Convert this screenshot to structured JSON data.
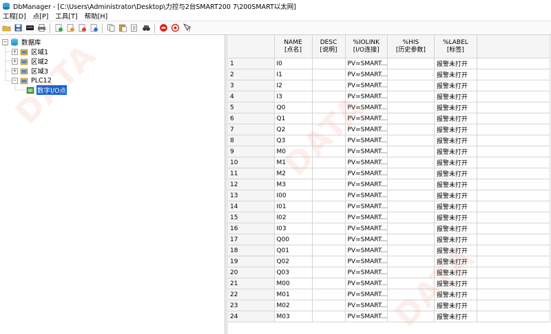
{
  "window": {
    "title": "DbManager - [C:\\Users\\Administrator\\Desktop\\力控与2台SMART200  7\\200SMART以太网]"
  },
  "menu": [
    "工程[D]",
    "点[P]",
    "工具[T]",
    "帮助[H]"
  ],
  "toolbar_icons": [
    "open-folder-icon",
    "save-icon",
    "card-icon",
    "print-icon",
    "import-icon",
    "export-icon",
    "add-point-icon",
    "delete-point-icon",
    "copy-icon",
    "paste-icon",
    "paste-special-icon",
    "find-icon",
    "stop-icon",
    "target-icon",
    "help-pointer-icon"
  ],
  "tree": {
    "root": "数据库",
    "areas": [
      "区域1",
      "区域2",
      "区域3"
    ],
    "plc": "PLC12",
    "selected": "数字I/O点"
  },
  "grid": {
    "headers": [
      {
        "top": "",
        "bottom": ""
      },
      {
        "top": "NAME",
        "bottom": "[点名]"
      },
      {
        "top": "DESC",
        "bottom": "[说明]"
      },
      {
        "top": "%IOLINK",
        "bottom": "[I/O连接]"
      },
      {
        "top": "%HIS",
        "bottom": "[历史参数]"
      },
      {
        "top": "%LABEL",
        "bottom": "[标签]"
      },
      {
        "top": "",
        "bottom": ""
      }
    ],
    "rows": [
      {
        "n": "1",
        "name": "I0",
        "desc": "",
        "iolink": "PV=SMART...",
        "his": "",
        "label": "报警未打开"
      },
      {
        "n": "2",
        "name": "I1",
        "desc": "",
        "iolink": "PV=SMART...",
        "his": "",
        "label": "报警未打开"
      },
      {
        "n": "3",
        "name": "I2",
        "desc": "",
        "iolink": "PV=SMART...",
        "his": "",
        "label": "报警未打开"
      },
      {
        "n": "4",
        "name": "I3",
        "desc": "",
        "iolink": "PV=SMART...",
        "his": "",
        "label": "报警未打开"
      },
      {
        "n": "5",
        "name": "Q0",
        "desc": "",
        "iolink": "PV=SMART...",
        "his": "",
        "label": "报警未打开"
      },
      {
        "n": "6",
        "name": "Q1",
        "desc": "",
        "iolink": "PV=SMART...",
        "his": "",
        "label": "报警未打开"
      },
      {
        "n": "7",
        "name": "Q2",
        "desc": "",
        "iolink": "PV=SMART...",
        "his": "",
        "label": "报警未打开"
      },
      {
        "n": "8",
        "name": "Q3",
        "desc": "",
        "iolink": "PV=SMART...",
        "his": "",
        "label": "报警未打开"
      },
      {
        "n": "9",
        "name": "M0",
        "desc": "",
        "iolink": "PV=SMART...",
        "his": "",
        "label": "报警未打开"
      },
      {
        "n": "10",
        "name": "M1",
        "desc": "",
        "iolink": "PV=SMART...",
        "his": "",
        "label": "报警未打开"
      },
      {
        "n": "11",
        "name": "M2",
        "desc": "",
        "iolink": "PV=SMART...",
        "his": "",
        "label": "报警未打开"
      },
      {
        "n": "12",
        "name": "M3",
        "desc": "",
        "iolink": "PV=SMART...",
        "his": "",
        "label": "报警未打开"
      },
      {
        "n": "13",
        "name": "I00",
        "desc": "",
        "iolink": "PV=SMART...",
        "his": "",
        "label": "报警未打开"
      },
      {
        "n": "14",
        "name": "I01",
        "desc": "",
        "iolink": "PV=SMART...",
        "his": "",
        "label": "报警未打开"
      },
      {
        "n": "15",
        "name": "I02",
        "desc": "",
        "iolink": "PV=SMART...",
        "his": "",
        "label": "报警未打开"
      },
      {
        "n": "16",
        "name": "I03",
        "desc": "",
        "iolink": "PV=SMART...",
        "his": "",
        "label": "报警未打开"
      },
      {
        "n": "17",
        "name": "Q00",
        "desc": "",
        "iolink": "PV=SMART...",
        "his": "",
        "label": "报警未打开"
      },
      {
        "n": "18",
        "name": "Q01",
        "desc": "",
        "iolink": "PV=SMART...",
        "his": "",
        "label": "报警未打开"
      },
      {
        "n": "19",
        "name": "Q02",
        "desc": "",
        "iolink": "PV=SMART...",
        "his": "",
        "label": "报警未打开"
      },
      {
        "n": "20",
        "name": "Q03",
        "desc": "",
        "iolink": "PV=SMART...",
        "his": "",
        "label": "报警未打开"
      },
      {
        "n": "21",
        "name": "M00",
        "desc": "",
        "iolink": "PV=SMART...",
        "his": "",
        "label": "报警未打开"
      },
      {
        "n": "22",
        "name": "M01",
        "desc": "",
        "iolink": "PV=SMART...",
        "his": "",
        "label": "报警未打开"
      },
      {
        "n": "23",
        "name": "M02",
        "desc": "",
        "iolink": "PV=SMART...",
        "his": "",
        "label": "报警未打开"
      },
      {
        "n": "24",
        "name": "M03",
        "desc": "",
        "iolink": "PV=SMART...",
        "his": "",
        "label": "报警未打开"
      }
    ]
  },
  "watermark": "DATA",
  "colors": {
    "selection": "#0a64d8",
    "header_bg": "#f5f5f5",
    "grid_line": "#d4d4d4"
  }
}
